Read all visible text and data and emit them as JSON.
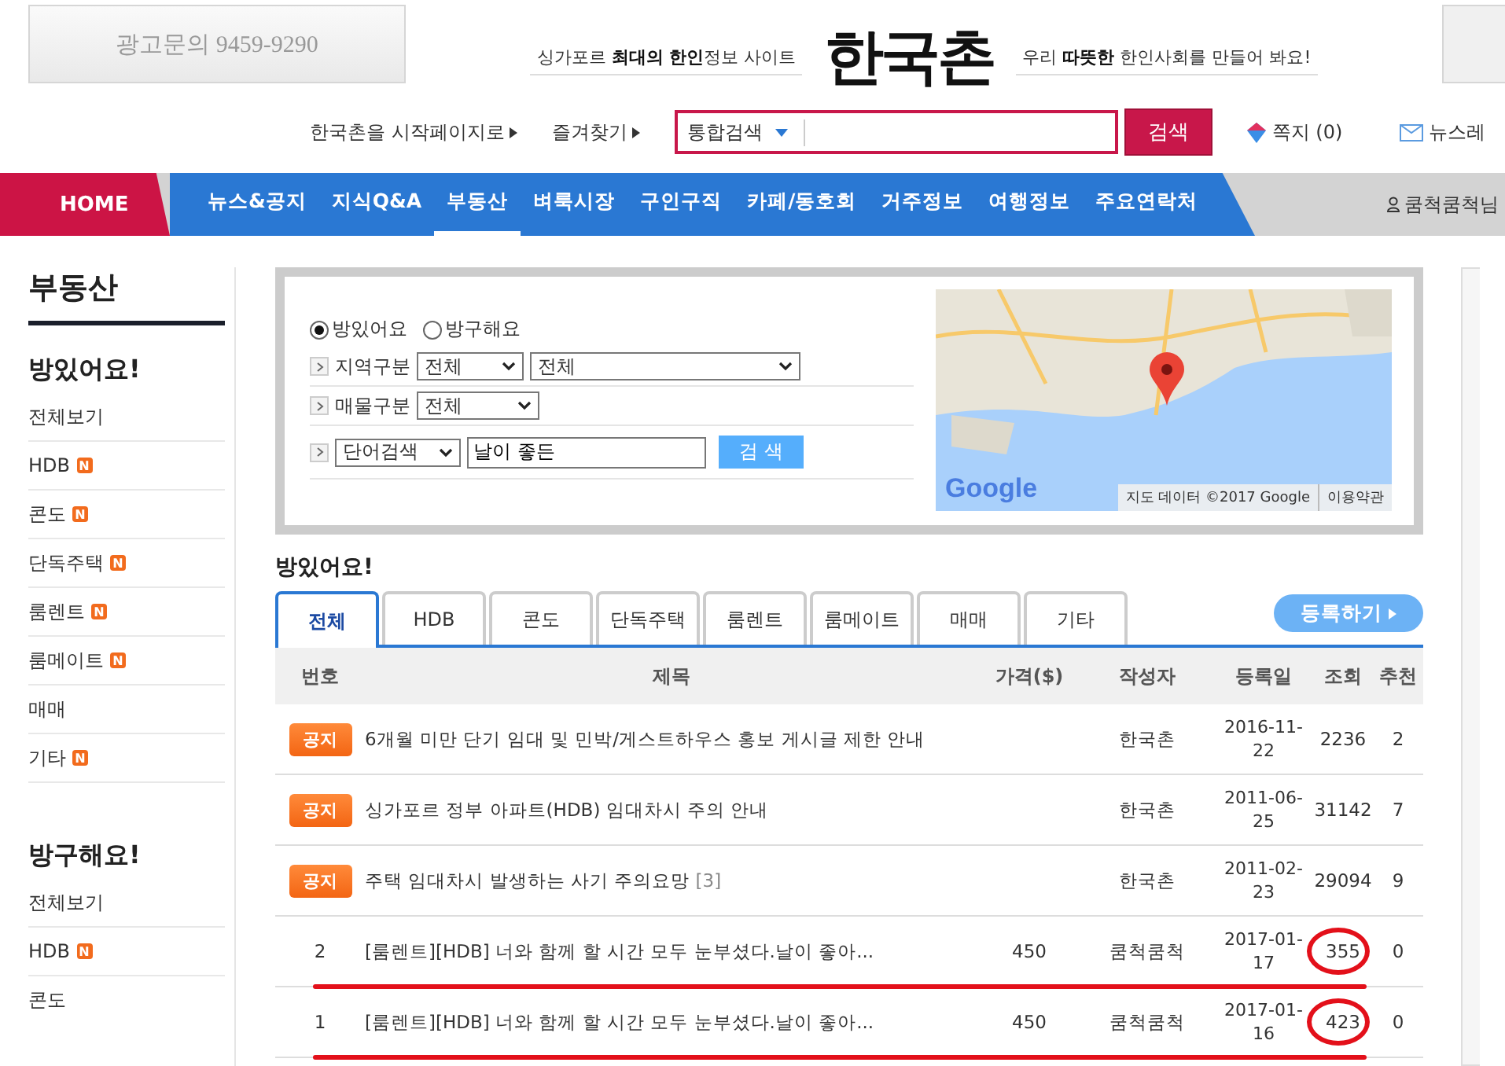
{
  "header": {
    "ad_left": "광고문의 9459-9290",
    "tagline_left": "싱가포르 **최대의 한인**정보 사이트",
    "logo": "한국촌",
    "tagline_right": "우리 **따뜻한** 한인사회를 만들어 봐요!",
    "links": [
      "한국촌을 시작페이지로",
      "즐겨찾기"
    ],
    "search": {
      "scope": "통합검색",
      "button": "검색"
    },
    "memo": {
      "label": "쪽지",
      "count": "(0)"
    },
    "newsletter": "뉴스레"
  },
  "nav": {
    "home": "HOME",
    "items": [
      {
        "label": "뉴스&공지",
        "selected": false
      },
      {
        "label": "지식Q&A",
        "selected": false
      },
      {
        "label": "부동산",
        "selected": true
      },
      {
        "label": "벼룩시장",
        "selected": false
      },
      {
        "label": "구인구직",
        "selected": false
      },
      {
        "label": "카페/동호회",
        "selected": false
      },
      {
        "label": "거주정보",
        "selected": false
      },
      {
        "label": "여행정보",
        "selected": false
      },
      {
        "label": "주요연락처",
        "selected": false
      }
    ],
    "user": "쿰척쿰척님"
  },
  "sidebar": {
    "title": "부동산",
    "sections": [
      {
        "heading": "방있어요!",
        "items": [
          {
            "label": "전체보기"
          },
          {
            "label": "HDB",
            "badge": "N"
          },
          {
            "label": "콘도",
            "badge": "N"
          },
          {
            "label": "단독주택",
            "badge": "N"
          },
          {
            "label": "룸렌트",
            "badge": "N"
          },
          {
            "label": "룸메이트",
            "badge": "N"
          },
          {
            "label": "매매"
          },
          {
            "label": "기타",
            "badge": "N"
          }
        ]
      },
      {
        "heading": "방구해요!",
        "items": [
          {
            "label": "전체보기"
          },
          {
            "label": "HDB",
            "badge": "N"
          },
          {
            "label": "콘도"
          }
        ]
      }
    ]
  },
  "search_panel": {
    "radios": [
      {
        "label": "방있어요",
        "selected": true
      },
      {
        "label": "방구해요",
        "selected": false
      }
    ],
    "region": {
      "label": "지역구분",
      "selects": [
        "전체",
        "전체"
      ]
    },
    "property": {
      "label": "매물구분",
      "select": "전체"
    },
    "keyword": {
      "select": "단어검색",
      "value": "날이 좋든",
      "button": "검 색"
    }
  },
  "map": {
    "logo": "Google",
    "attribution": "지도 데이터 ©2017 Google",
    "terms": "이용약관"
  },
  "board": {
    "title": "방있어요!",
    "tabs": [
      {
        "label": "전체",
        "selected": true
      },
      {
        "label": "HDB",
        "selected": false
      },
      {
        "label": "콘도",
        "selected": false
      },
      {
        "label": "단독주택",
        "selected": false
      },
      {
        "label": "룸렌트",
        "selected": false
      },
      {
        "label": "룸메이트",
        "selected": false
      },
      {
        "label": "매매",
        "selected": false
      },
      {
        "label": "기타",
        "selected": false
      }
    ],
    "register_button": "등록하기",
    "columns": [
      "번호",
      "제목",
      "가격($)",
      "작성자",
      "등록일",
      "조회",
      "추천"
    ],
    "rows": [
      {
        "kind": "notice",
        "number": "공지",
        "title": "6개월 미만 단기 임대 및 민박/게스트하우스 홍보 게시글 제한 안내",
        "author": "한국촌",
        "date": [
          "2016-11-",
          "22"
        ],
        "views": "2236",
        "recommends": "2",
        "marked": false
      },
      {
        "kind": "notice",
        "number": "공지",
        "title": "싱가포르 정부 아파트(HDB) 임대차시 주의 안내",
        "author": "한국촌",
        "date": [
          "2011-06-",
          "25"
        ],
        "views": "31142",
        "recommends": "7",
        "marked": false
      },
      {
        "kind": "notice",
        "number": "공지",
        "title": "주택 임대차시 발생하는 사기 주의요망",
        "comments": "[3]",
        "author": "한국촌",
        "date": [
          "2011-02-",
          "23"
        ],
        "views": "29094",
        "recommends": "9",
        "marked": false
      },
      {
        "kind": "post",
        "number": "2",
        "title": "[룸렌트][HDB] 너와 함께 할 시간 모두 눈부셨다.날이 좋아...",
        "price": "450",
        "author": "쿰척쿰척",
        "date": [
          "2017-01-",
          "17"
        ],
        "views": "355",
        "recommends": "0",
        "marked": true
      },
      {
        "kind": "post",
        "number": "1",
        "title": "[룸렌트][HDB] 너와 함께 할 시간 모두 눈부셨다.날이 좋아...",
        "price": "450",
        "author": "쿰척쿰척",
        "date": [
          "2017-01-",
          "16"
        ],
        "views": "423",
        "recommends": "0",
        "marked": true
      }
    ]
  }
}
